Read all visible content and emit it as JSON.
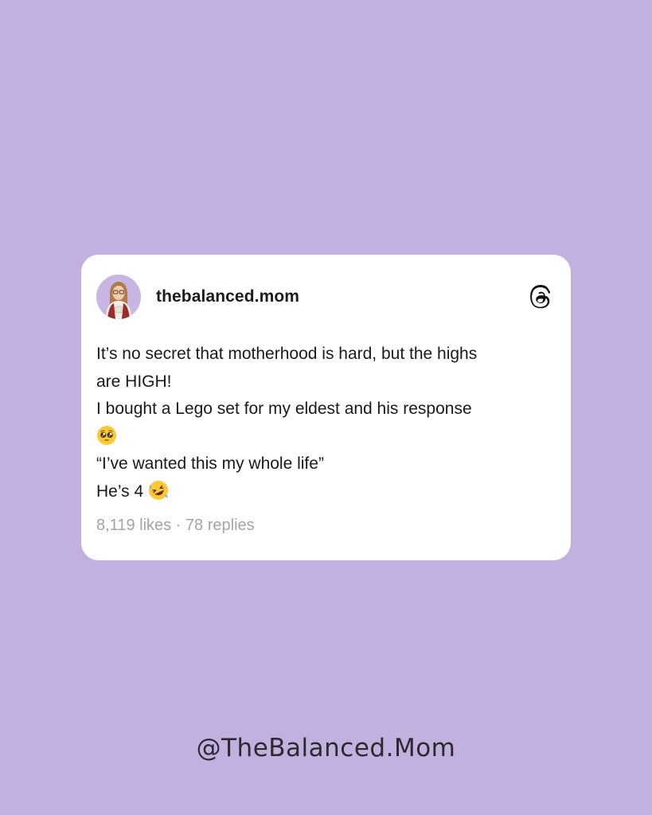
{
  "post": {
    "username": "thebalanced.mom",
    "avatar_icon": "profile-photo",
    "platform_icon": "threads-logo-icon",
    "lines": [
      "It’s no secret that motherhood is hard, but the highs",
      "are HIGH!",
      "I bought a Lego set for my eldest and his response",
      "",
      "“I’ve wanted this my whole life”",
      "He’s 4"
    ],
    "emojis": {
      "line4": "pleading-face-emoji",
      "line6": "rolling-on-floor-laughing-emoji"
    },
    "likes": "8,119 likes",
    "separator": " · ",
    "replies": "78 replies"
  },
  "footer": {
    "handle": "@TheBalanced.Mom"
  },
  "colors": {
    "background": "#c2b0e1",
    "card": "#ffffff",
    "text": "#1a1a1a",
    "muted": "#a4a4a4"
  }
}
